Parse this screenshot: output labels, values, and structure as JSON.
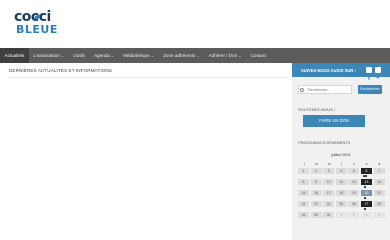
{
  "brand": {
    "logo_line1": "cocci",
    "logo_line2": "BLEUE"
  },
  "nav": {
    "items": [
      {
        "label": "Actualités",
        "dropdown": false,
        "active": true
      },
      {
        "label": "L'association",
        "dropdown": true
      },
      {
        "label": "Outils",
        "dropdown": false
      },
      {
        "label": "Agenda",
        "dropdown": true
      },
      {
        "label": "Médiathèque",
        "dropdown": true
      },
      {
        "label": "Zone adhérents",
        "dropdown": true
      },
      {
        "label": "Adhérer / Don",
        "dropdown": true
      },
      {
        "label": "Contact",
        "dropdown": false
      }
    ]
  },
  "main": {
    "title": "DERNIÈRES ACTUALITÉS ET INFORMATIONS"
  },
  "sidebar": {
    "follow_label": "SUIVEZ-NOUS AUSSI SUR :",
    "search_placeholder": "Rechercher...",
    "search_button": "Rechercher",
    "support_title": "SOUTENEZ-NOUS !",
    "don_button": "FAIRE UN DON",
    "events_title": "PROCHAINS ÉVÈNEMENTS",
    "calendar": {
      "month": "juillet 2024",
      "weekdays": [
        "l",
        "m",
        "m",
        "j",
        "v",
        "s",
        "d"
      ],
      "weeks": [
        [
          "1",
          "2",
          "3",
          "4",
          "5",
          "6",
          "7"
        ],
        [
          "8",
          "9",
          "10",
          "11",
          "12",
          "13",
          "14"
        ],
        [
          "15",
          "16",
          "17",
          "18",
          "19",
          "20",
          "21"
        ],
        [
          "22",
          "23",
          "24",
          "25",
          "26",
          "27",
          "28"
        ],
        [
          "29",
          "30",
          "31",
          "1",
          "2",
          "3",
          "4"
        ]
      ]
    }
  },
  "colors": {
    "accent": "#3d86b8",
    "nav_bg": "#5c5c5c",
    "sidebar_bg": "#f1f1f1"
  }
}
